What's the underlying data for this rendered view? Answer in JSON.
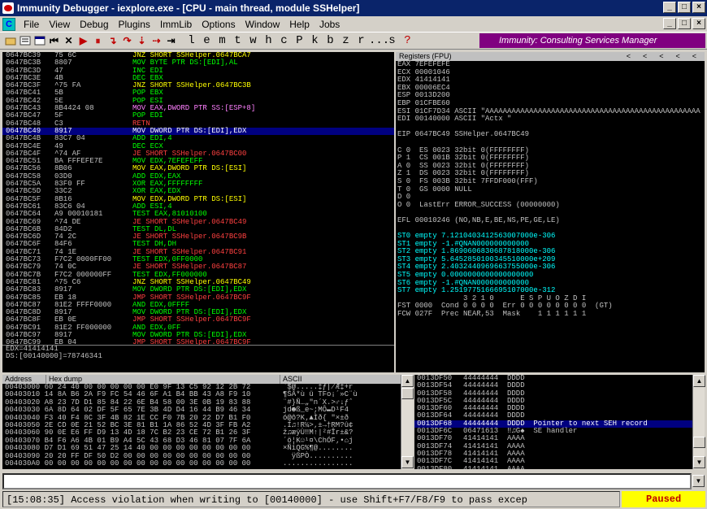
{
  "window": {
    "title": "Immunity Debugger - iexplore.exe - [CPU - main thread, module SSHelper]"
  },
  "menu": [
    "File",
    "View",
    "Debug",
    "Plugins",
    "ImmLib",
    "Options",
    "Window",
    "Help",
    "Jobs"
  ],
  "toolbar": {
    "letters": [
      "l",
      "e",
      "m",
      "t",
      "w",
      "h",
      "c",
      "P",
      "k",
      "b",
      "z",
      "r",
      "...",
      "s",
      "?"
    ],
    "banner": "Immunity: Consulting Services Manager"
  },
  "cpu": [
    {
      "addr": "0647BC39",
      "hex": "75 6C",
      "instr": "JNZ SHORT SSHelper.0647BCA7",
      "cls": "cy"
    },
    {
      "addr": "0647BC3B",
      "hex": "8807",
      "instr": "MOV BYTE PTR DS:[EDI],AL",
      "cls": "cg"
    },
    {
      "addr": "0647BC3D",
      "hex": "47",
      "instr": "INC EDI",
      "cls": "cg"
    },
    {
      "addr": "0647BC3E",
      "hex": "4B",
      "instr": "DEC EBX",
      "cls": "cg"
    },
    {
      "addr": "0647BC3F",
      "hex": "^75 FA",
      "instr": "JNZ SHORT SSHelper.0647BC3B",
      "cls": "cy"
    },
    {
      "addr": "0647BC41",
      "hex": "5B",
      "instr": "POP EBX",
      "cls": "cg"
    },
    {
      "addr": "0647BC42",
      "hex": "5E",
      "instr": "POP ESI",
      "cls": "cg"
    },
    {
      "addr": "0647BC43",
      "hex": "8B4424 08",
      "instr": "MOV EAX,DWORD PTR SS:[ESP+8]",
      "cls": "cm"
    },
    {
      "addr": "0647BC47",
      "hex": "5F",
      "instr": "POP EDI",
      "cls": "cg"
    },
    {
      "addr": "0647BC48",
      "hex": "C3",
      "instr": "RETN",
      "cls": "cr"
    },
    {
      "addr": "0647BC49",
      "hex": "8917",
      "instr": "MOV DWORD PTR DS:[EDI],EDX",
      "cls": "cw",
      "sel": true
    },
    {
      "addr": "0647BC4B",
      "hex": "83C7 04",
      "instr": "ADD EDI,4",
      "cls": "cg"
    },
    {
      "addr": "0647BC4E",
      "hex": "49",
      "instr": "DEC ECX",
      "cls": "cg"
    },
    {
      "addr": "0647BC4F",
      "hex": "^74 AF",
      "instr": "JE SHORT SSHelper.0647BC00",
      "cls": "cr"
    },
    {
      "addr": "0647BC51",
      "hex": "BA FFFEFE7E",
      "instr": "MOV EDX,7EFEFEFF",
      "cls": "cg"
    },
    {
      "addr": "0647BC56",
      "hex": "8B06",
      "instr": "MOV EAX,DWORD PTR DS:[ESI]",
      "cls": "cy"
    },
    {
      "addr": "0647BC58",
      "hex": "03D0",
      "instr": "ADD EDX,EAX",
      "cls": "cg"
    },
    {
      "addr": "0647BC5A",
      "hex": "83F0 FF",
      "instr": "XOR EAX,FFFFFFFF",
      "cls": "cg"
    },
    {
      "addr": "0647BC5D",
      "hex": "33C2",
      "instr": "XOR EAX,EDX",
      "cls": "cg"
    },
    {
      "addr": "0647BC5F",
      "hex": "8B16",
      "instr": "MOV EDX,DWORD PTR DS:[ESI]",
      "cls": "cy"
    },
    {
      "addr": "0647BC61",
      "hex": "83C6 04",
      "instr": "ADD ESI,4",
      "cls": "cg"
    },
    {
      "addr": "0647BC64",
      "hex": "A9 00010181",
      "instr": "TEST EAX,81010100",
      "cls": "cg"
    },
    {
      "addr": "0647BC69",
      "hex": "^74 DE",
      "instr": "JE SHORT SSHelper.0647BC49",
      "cls": "cr"
    },
    {
      "addr": "0647BC6B",
      "hex": "84D2",
      "instr": "TEST DL,DL",
      "cls": "cg"
    },
    {
      "addr": "0647BC6D",
      "hex": "74 2C",
      "instr": "JE SHORT SSHelper.0647BC9B",
      "cls": "cr"
    },
    {
      "addr": "0647BC6F",
      "hex": "84F6",
      "instr": "TEST DH,DH",
      "cls": "cg"
    },
    {
      "addr": "0647BC71",
      "hex": "74 1E",
      "instr": "JE SHORT SSHelper.0647BC91",
      "cls": "cr"
    },
    {
      "addr": "0647BC73",
      "hex": "F7C2 0000FF00",
      "instr": "TEST EDX,0FF0000",
      "cls": "cg"
    },
    {
      "addr": "0647BC79",
      "hex": "74 0C",
      "instr": "JE SHORT SSHelper.0647BC87",
      "cls": "cr"
    },
    {
      "addr": "0647BC7B",
      "hex": "F7C2 000000FF",
      "instr": "TEST EDX,FF000000",
      "cls": "cg"
    },
    {
      "addr": "0647BC81",
      "hex": "^75 C6",
      "instr": "JNZ SHORT SSHelper.0647BC49",
      "cls": "cy"
    },
    {
      "addr": "0647BC83",
      "hex": "8917",
      "instr": "MOV DWORD PTR DS:[EDI],EDX",
      "cls": "cg"
    },
    {
      "addr": "0647BC85",
      "hex": "EB 18",
      "instr": "JMP SHORT SSHelper.0647BC9F",
      "cls": "cr"
    },
    {
      "addr": "0647BC87",
      "hex": "81E2 FFFF0000",
      "instr": "AND EDX,0FFFF",
      "cls": "cg"
    },
    {
      "addr": "0647BC8D",
      "hex": "8917",
      "instr": "MOV DWORD PTR DS:[EDI],EDX",
      "cls": "cg"
    },
    {
      "addr": "0647BC8F",
      "hex": "EB 0E",
      "instr": "JMP SHORT SSHelper.0647BC9F",
      "cls": "cr"
    },
    {
      "addr": "0647BC91",
      "hex": "81E2 FF000000",
      "instr": "AND EDX,0FF",
      "cls": "cg"
    },
    {
      "addr": "0647BC97",
      "hex": "8917",
      "instr": "MOV DWORD PTR DS:[EDI],EDX",
      "cls": "cg"
    },
    {
      "addr": "0647BC99",
      "hex": "EB 04",
      "instr": "JMP SHORT SSHelper.0647BC9F",
      "cls": "cr"
    }
  ],
  "info": [
    "EDX=41414141",
    "DS:[00140000]=78746341"
  ],
  "registers": {
    "title": "Registers (FPU)",
    "lines": [
      "EAX 7EFEFEFE",
      "ECX 00001046",
      "EDX 41414141",
      "EBX 00006EC4",
      "ESP 0013D200",
      "EBP 01CFBE60",
      "ESI 01CF7D34 ASCII \"AAAAAAAAAAAAAAAAAAAAAAAAAAAAAAAAAAAAAAAAAAAAAAAAA",
      "EDI 00140000 ASCII \"Actx \"",
      "",
      "EIP 0647BC49 SSHelper.0647BC49",
      "",
      "C 0  ES 0023 32bit 0(FFFFFFFF)",
      "P 1  CS 001B 32bit 0(FFFFFFFF)",
      "A 0  SS 0023 32bit 0(FFFFFFFF)",
      "Z 1  DS 0023 32bit 0(FFFFFFFF)",
      "S 0  FS 003B 32bit 7FFDF000(FFF)",
      "T 0  GS 0000 NULL",
      "D 0",
      "O 0  LastErr ERROR_SUCCESS (00000000)",
      "",
      "EFL 00010246 (NO,NB,E,BE,NS,PE,GE,LE)",
      "",
      "ST0 empty 7.1210403412563007000e-306",
      "ST1 empty -1.#QNAN000000000000",
      "ST2 empty 1.8690606830687818000e-306",
      "ST3 empty 5.6452850100345510000e+209",
      "ST4 empty 2.4032440969663755000e-306",
      "ST5 empty 0.0000000000000000000",
      "ST6 empty -1.#QNAN000000000000",
      "ST7 empty 1.2519775166695107000e-312",
      "               3 2 1 0      E S P U O Z D I",
      "FST 0000  Cond 0 0 0 0  Err 0 0 0 0 0 0 0 0  (GT)",
      "FCW 027F  Prec NEAR,53  Mask    1 1 1 1 1 1"
    ]
  },
  "dump": {
    "headers": [
      "Address",
      "Hex dump",
      "ASCII"
    ],
    "rows": [
      "00403000 60 24 40 00 00 00 00 00 E0 9F 13 C5 92 12 2B 72",
      "00403010 14 8A B6 2A F9 FC 54 46 6F A1 B4 BB 43 A8 F9 10",
      "00403020 A8 23 7D D1 85 84 22 6E B4 58 00 3E 0B 19 83 88",
      "00403030 6A 8D 64 02 DF 5F 65 7E 3B 4D D4 16 44 B9 46 34",
      "00403040 F3 40 F4 8C 3F 4B 82 1E CC F0 7B 20 22 D7 B1 F0",
      "00403050 2E CD 0E 21 52 BC 3E 81 B1 1A 86 52 4D 3F FB A2",
      "00403060 90 0E E6 FF D9 13 4D 18 7C B2 23 CE 72 B1 26 3F",
      "00403070 B4 F6 A6 4B 01 B9 A4 5C 43 68 D3 46 81 07 7F 6A",
      "00403080 D7 D1 69 51 47 25 14 40 00 00 00 00 00 00 00 00",
      "00403090 20 20 FF DF 50 D2 00 00 00 00 00 00 00 00 00 00",
      "004030A0 00 00 00 00 00 00 00 00 00 00 00 00 00 00 00 00"
    ],
    "ascii": [
      "`$@.....‡ƒ∤Æ‡+r",
      "¶ŠÂ*ù ü TFo¡´»C¨ù",
      "¨#}Ñ…„\"n´X.>♂↓ƒˆ",
      "jd☻ß_e~;MÔ▬D¹F4",
      "ó@ô?K‚▲Ìð{ \"×±ð",
      ".Í♫!R¼>‚±→†RM?û¢",
      "ž♫æÿÙ‼M↑|²#Îr±&?",
      "´ö¦K☺¹¤\\ChÓF‚•⌂j",
      "×ÑiQG%¶@........",
      "  ÿßPÒ..........",
      "................"
    ]
  },
  "stack": [
    {
      "a": "0013DF50",
      "v": "44444444",
      "c": "DDDD"
    },
    {
      "a": "0013DF54",
      "v": "44444444",
      "c": "DDDD"
    },
    {
      "a": "0013DF58",
      "v": "44444444",
      "c": "DDDD"
    },
    {
      "a": "0013DF5C",
      "v": "44444444",
      "c": "DDDD"
    },
    {
      "a": "0013DF60",
      "v": "44444444",
      "c": "DDDD"
    },
    {
      "a": "0013DF64",
      "v": "44444444",
      "c": "DDDD"
    },
    {
      "a": "0013DF68",
      "v": "44444444",
      "c": "DDDD  Pointer to next SEH record",
      "sel": true
    },
    {
      "a": "0013DF6C",
      "v": "06471613",
      "c": "‼♫G♠  SE handler"
    },
    {
      "a": "0013DF70",
      "v": "41414141",
      "c": "AAAA"
    },
    {
      "a": "0013DF74",
      "v": "41414141",
      "c": "AAAA"
    },
    {
      "a": "0013DF78",
      "v": "41414141",
      "c": "AAAA"
    },
    {
      "a": "0013DF7C",
      "v": "41414141",
      "c": "AAAA"
    },
    {
      "a": "0013DF80",
      "v": "41414141",
      "c": "AAAA"
    }
  ],
  "status": {
    "message": "[15:08:35] Access violation when writing to [00140000] - use Shift+F7/F8/F9 to pass excep",
    "state": "Paused"
  }
}
